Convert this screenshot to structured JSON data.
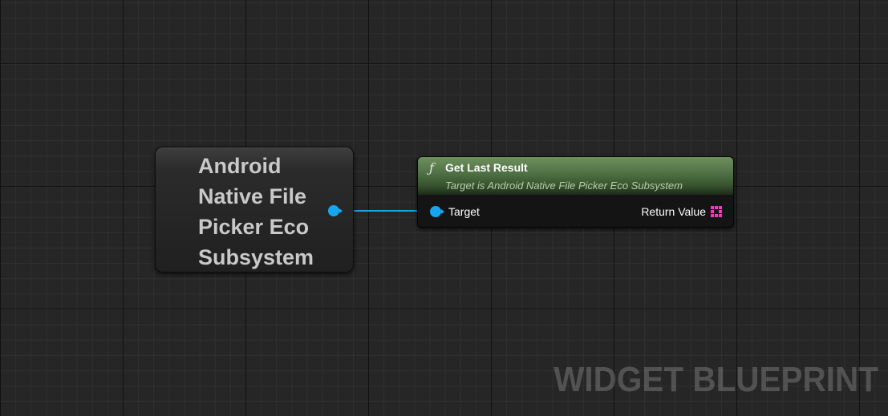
{
  "graph": {
    "watermark": "WIDGET BLUEPRINT"
  },
  "self_node": {
    "title": "Android Native File Picker Eco Subsystem",
    "pin_color": "#16a6f1"
  },
  "function_node": {
    "icon": "function-icon",
    "icon_glyph": "ƒ",
    "title": "Get Last Result",
    "subtitle": "Target is Android Native File Picker Eco Subsystem",
    "header_color": "#5b7d4e",
    "input_pin_label": "Target",
    "output_pin_label": "Return Value",
    "output_pin_color": "#ff2fd1"
  },
  "wire": {
    "from": "self_node.output",
    "to": "function_node.target",
    "color": "#1aa3e8"
  }
}
